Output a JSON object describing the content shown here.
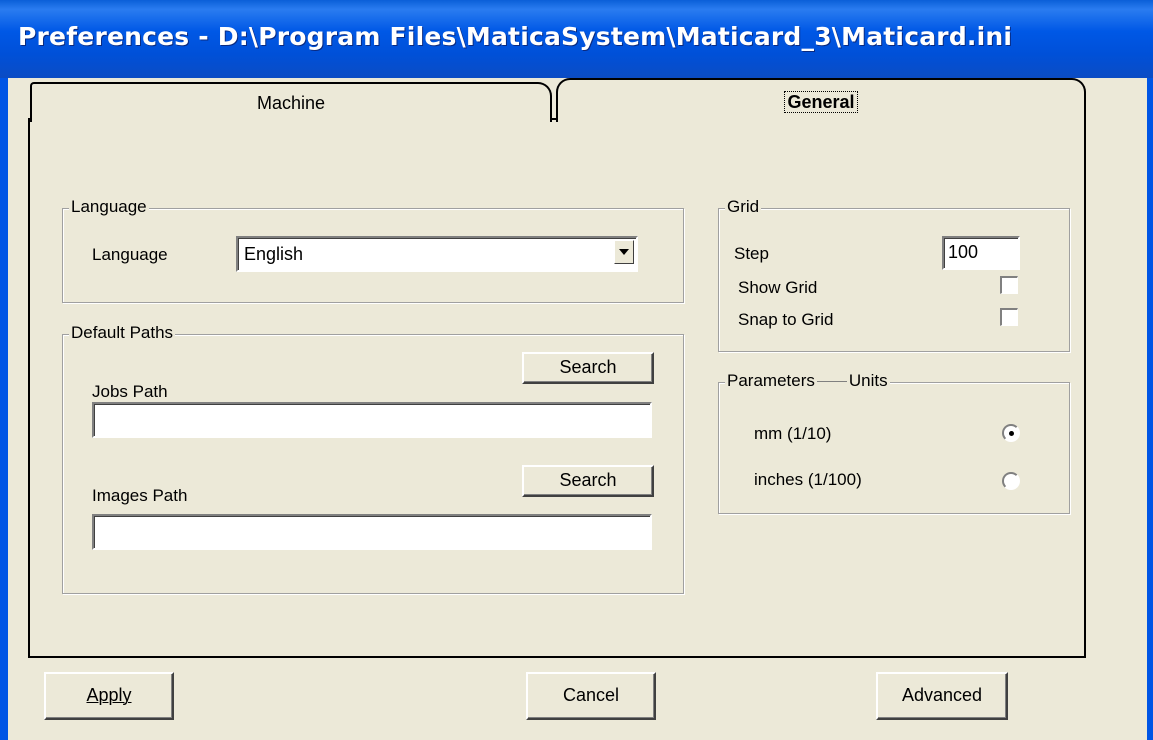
{
  "window": {
    "title": "Preferences - D:\\Program Files\\MaticaSystem\\Maticard_3\\Maticard.ini"
  },
  "tabs": {
    "machine": "Machine",
    "general": "General"
  },
  "language_group": {
    "caption": "Language",
    "label": "Language",
    "selected": "English"
  },
  "paths_group": {
    "caption": "Default Paths",
    "jobs_label": "Jobs Path",
    "jobs_value": "",
    "jobs_search": "Search",
    "images_label": "Images Path",
    "images_value": "",
    "images_search": "Search"
  },
  "grid_group": {
    "caption": "Grid",
    "step_label": "Step",
    "step_value": "100",
    "show_grid_label": "Show Grid",
    "show_grid_checked": false,
    "snap_label": "Snap to Grid",
    "snap_checked": false
  },
  "units_group": {
    "caption_left": "Parameters",
    "caption_right": "Units",
    "options": [
      {
        "label": "mm (1/10)",
        "selected": true
      },
      {
        "label": "inches (1/100)",
        "selected": false
      }
    ]
  },
  "buttons": {
    "apply": "Apply",
    "cancel": "Cancel",
    "advanced": "Advanced"
  }
}
